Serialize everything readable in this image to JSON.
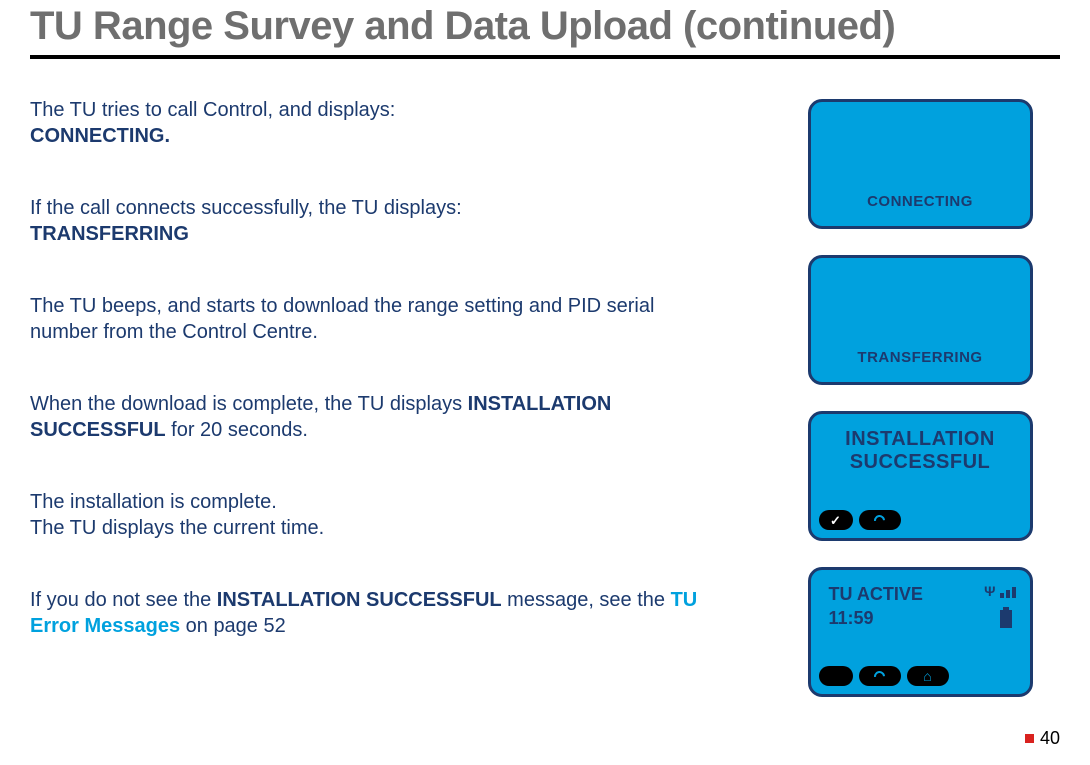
{
  "title": "TU Range Survey and Data Upload (continued)",
  "paragraphs": {
    "p1": {
      "lead": "The TU tries to call Control, and displays:",
      "bold": "CONNECTING."
    },
    "p2": {
      "lead": "If the call connects successfully, the TU displays:",
      "bold": "TRANSFERRING"
    },
    "p3": {
      "text": "The TU beeps, and starts to download the range setting and PID serial number from the Control Centre."
    },
    "p4": {
      "lead": "When the download is complete, the TU displays ",
      "bold": "INSTALLATION SUCCESSFUL",
      "tail": " for 20 seconds."
    },
    "p5": {
      "l1": "The installation is complete.",
      "l2": "The TU displays the current time."
    },
    "p6": {
      "lead": "If you do not see the ",
      "bold": "INSTALLATION SUCCESSFUL",
      "mid": " message, see the ",
      "link": "TU Error Messages",
      "tail": " on page 52"
    }
  },
  "screens": {
    "connecting": "CONNECTING",
    "transferring": "TRANSFERRING",
    "install_l1": "INSTALLATION",
    "install_l2": "SUCCESSFUL",
    "active_label": "TU ACTIVE",
    "active_time": "11:59"
  },
  "page_number": "40"
}
